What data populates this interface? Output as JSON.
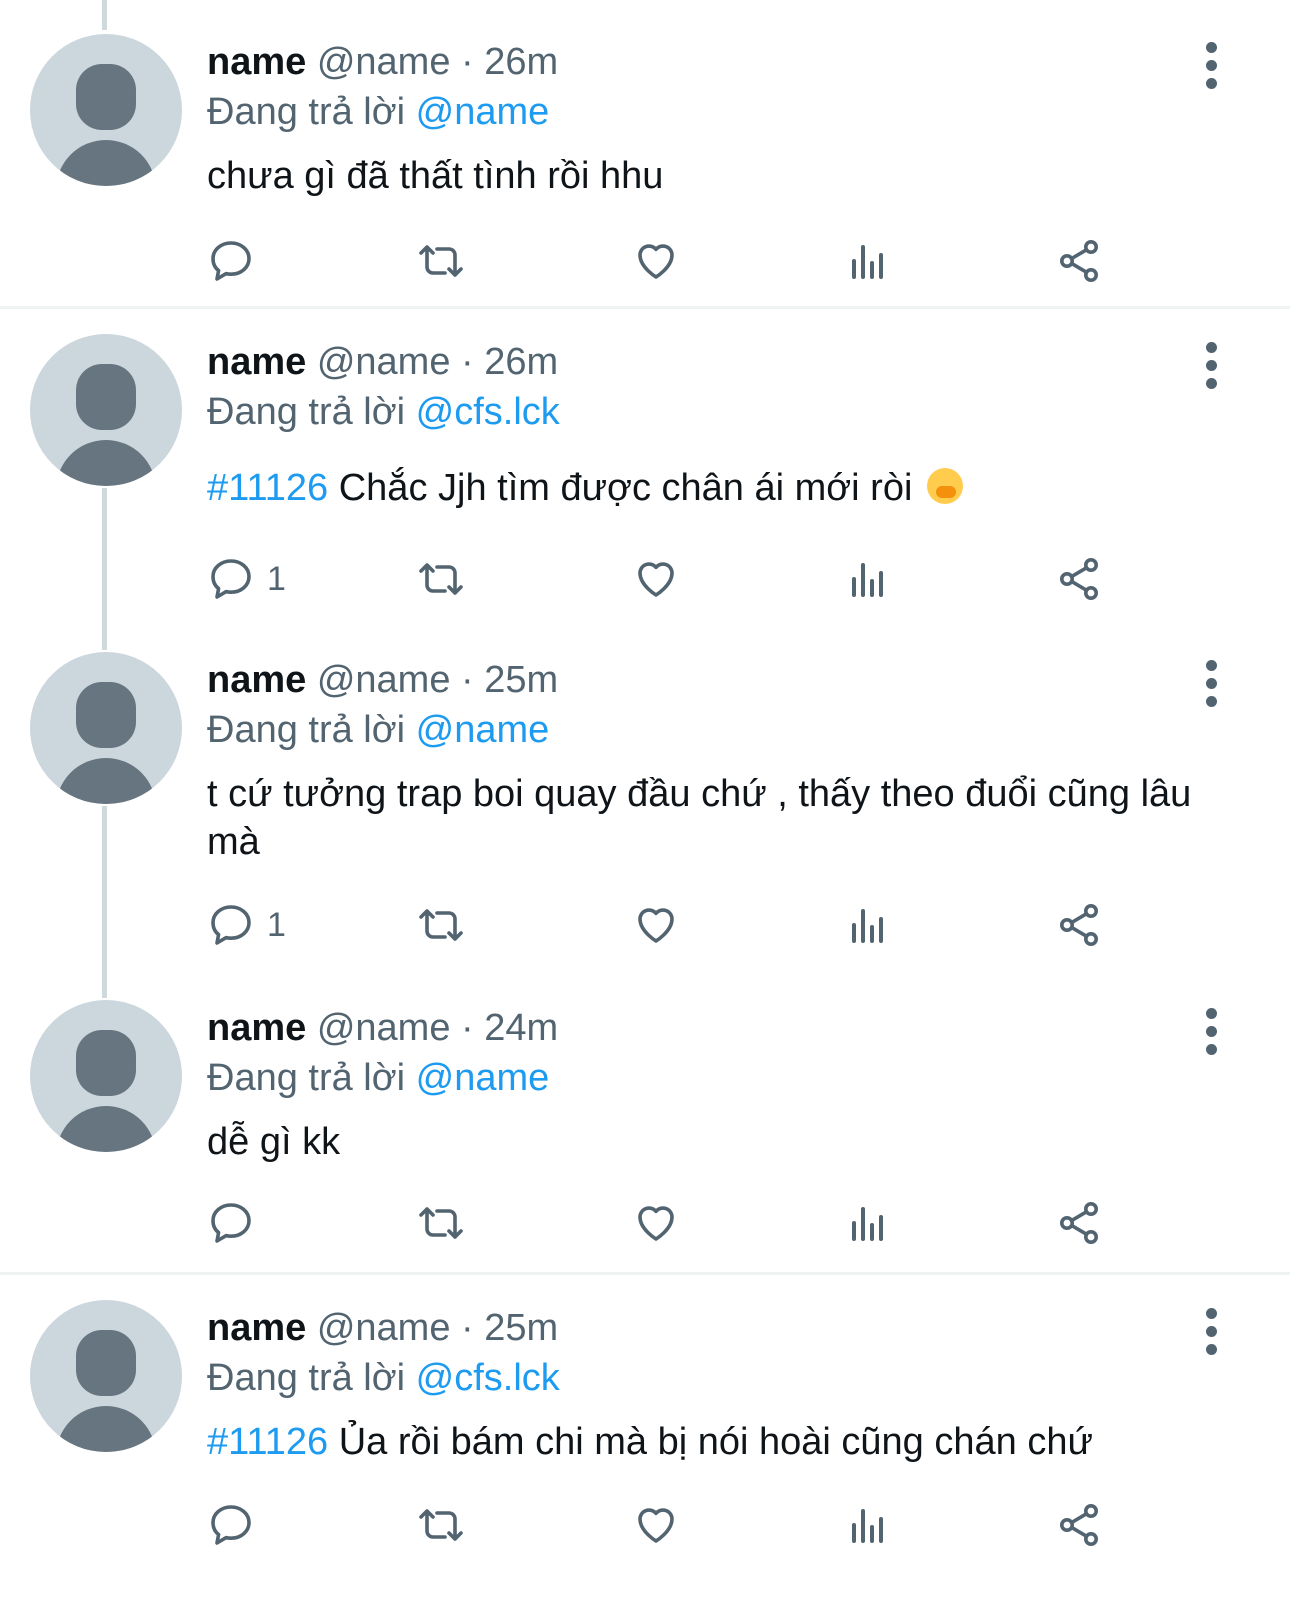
{
  "reply_prefix": "Đang trả lời",
  "tweets": [
    {
      "name": "name",
      "handle": "@name",
      "sep": "·",
      "time": "26m",
      "reply_to": "@name",
      "hashtag": "",
      "text": "chưa gì đã thất tình rồi hhu",
      "reply_count": ""
    },
    {
      "name": "name",
      "handle": "@name",
      "sep": "·",
      "time": "26m",
      "reply_to": "@cfs.lck",
      "hashtag": "#11126",
      "text": " Chắc Jjh tìm được chân ái mới ròi",
      "reply_count": "1"
    },
    {
      "name": "name",
      "handle": "@name",
      "sep": "·",
      "time": "25m",
      "reply_to": "@name",
      "hashtag": "",
      "text": "t cứ tưởng trap boi quay đầu chứ , thấy theo đuổi cũng lâu mà",
      "reply_count": "1"
    },
    {
      "name": "name",
      "handle": "@name",
      "sep": "·",
      "time": "24m",
      "reply_to": "@name",
      "hashtag": "",
      "text": "dễ gì kk",
      "reply_count": ""
    },
    {
      "name": "name",
      "handle": "@name",
      "sep": "·",
      "time": "25m",
      "reply_to": "@cfs.lck",
      "hashtag": "#11126",
      "text": " Ủa rồi bám chi mà bị nói hoài cũng chán chứ",
      "reply_count": ""
    }
  ],
  "icons": {
    "reply": "reply-icon",
    "retweet": "retweet-icon",
    "like": "heart-icon",
    "views": "views-icon",
    "share": "share-icon",
    "more": "more-icon",
    "avatar": "default-avatar"
  },
  "colors": {
    "accent": "#1d9bf0",
    "muted": "#536471",
    "avatar_bg": "#ccd6dd",
    "avatar_fg": "#66757f"
  }
}
